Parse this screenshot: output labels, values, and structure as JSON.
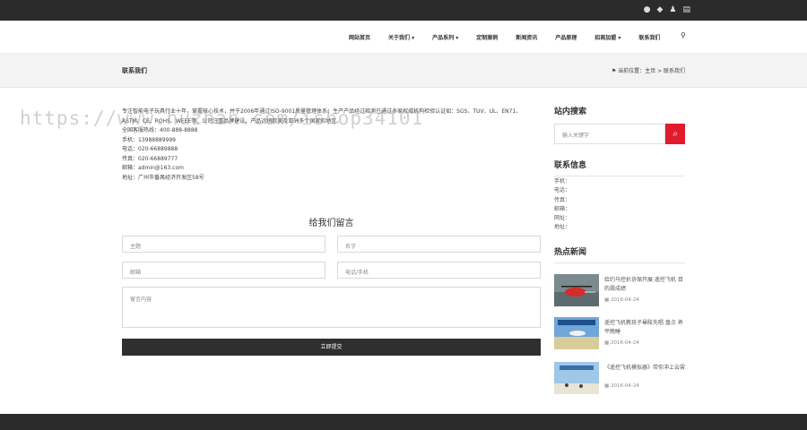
{
  "topbar": {
    "icons": [
      "weibo-icon",
      "wechat-icon",
      "user-icon",
      "cart-icon"
    ]
  },
  "nav": {
    "items": [
      "网站首页",
      "关于我们 ▾",
      "产品系列 ▾",
      "定制案例",
      "新闻资讯",
      "产品原理",
      "招商加盟 ▾",
      "联系我们"
    ],
    "search_icon": "search-icon"
  },
  "crumbbar": {
    "title": "联系我们",
    "crumb": "当前位置：主页 > 联系我们"
  },
  "content": {
    "intro": "专注智能电子玩具行业十年，掌握核心技术，并于2006年通过ISO-9001质量管理体系；生产产品经过检测已通过多家权威机构检验认证如：SGS、TUV、UL、EN71、ASTM、CE、ROHS、WEEE等。公司注重品牌建设，产品远销欧美及亚洲多个国家和地区。",
    "lines": [
      "全国客服热线：400-888-8888",
      "手机：13988889999",
      "电话：020-66889888",
      "传真：020-66889777",
      "邮箱：admin@163.com",
      "地址：广州市番禺经济开发区58号"
    ]
  },
  "watermark": "https://www.huzhan.com/ishop34101",
  "form": {
    "title": "给我们留言",
    "theme_placeholder": "主题",
    "name_placeholder": "名字",
    "email_placeholder": "邮箱",
    "phone_placeholder": "电话/手机",
    "message_placeholder": "留言内容",
    "submit_label": "立即提交"
  },
  "sidebar": {
    "search_title": "站内搜索",
    "search_placeholder": "输入关键字",
    "contact_title": "联系信息",
    "contact_lines": [
      "手机：",
      "电话：",
      "传真：",
      "邮箱：",
      "网址：",
      "地址："
    ],
    "news_title": "热点新闻",
    "news": [
      {
        "title": "给约马控扒协保开展 遥控飞机 目的震成绩",
        "date": "2016-04-24"
      },
      {
        "title": "遥控飞机教孩子晕眩先唱 盘点 养平晚睡",
        "date": "2016-04-24"
      },
      {
        "title": "《遥控飞机模拟器》带你冲上云霄",
        "date": "2016-04-24"
      }
    ]
  },
  "colors": {
    "accent": "#e21b2c",
    "dark": "#2b2b2b"
  }
}
